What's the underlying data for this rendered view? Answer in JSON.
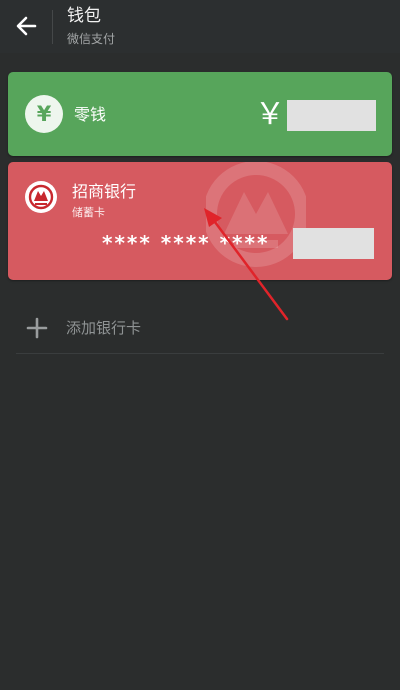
{
  "header": {
    "title": "钱包",
    "subtitle": "微信支付"
  },
  "change_card": {
    "icon_char": "¥",
    "label": "零钱",
    "currency_symbol": "￥",
    "accent_color": "#57a55b"
  },
  "bank_card": {
    "bank_name": "招商银行",
    "card_type": "储蓄卡",
    "masked_number": "**** **** ****",
    "accent_color": "#d65a60"
  },
  "add_card": {
    "label": "添加银行卡"
  },
  "icons": {
    "back": "arrow-left-icon",
    "change": "yen-coin-icon",
    "bank_logo": "cmb-bank-logo-icon",
    "add": "plus-icon"
  },
  "annotation": {
    "color": "#e0242a"
  }
}
